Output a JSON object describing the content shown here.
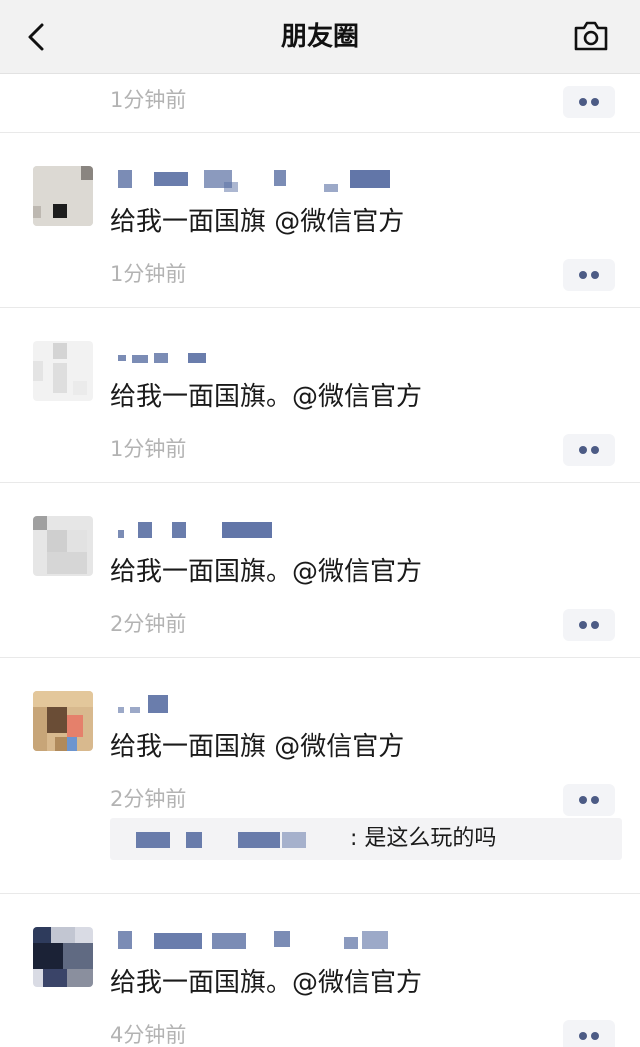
{
  "header": {
    "title": "朋友圈",
    "back_icon": "chevron-left-icon",
    "camera_icon": "camera-icon"
  },
  "posts": [
    {
      "timestamp": "1分钟前"
    },
    {
      "text": "给我一面国旗 @微信官方",
      "timestamp": "1分钟前"
    },
    {
      "text": "给我一面国旗。@微信官方",
      "timestamp": "1分钟前"
    },
    {
      "text": "给我一面国旗。@微信官方",
      "timestamp": "2分钟前"
    },
    {
      "text": "给我一面国旗 @微信官方",
      "timestamp": "2分钟前",
      "comment": ": 是这么玩的吗"
    },
    {
      "text": "给我一面国旗。@微信官方",
      "timestamp": "4分钟前"
    }
  ],
  "colors": {
    "link_blue": "#5a6fa3",
    "timestamp_gray": "#b3b3b3",
    "header_bg": "#f2f2f2"
  }
}
